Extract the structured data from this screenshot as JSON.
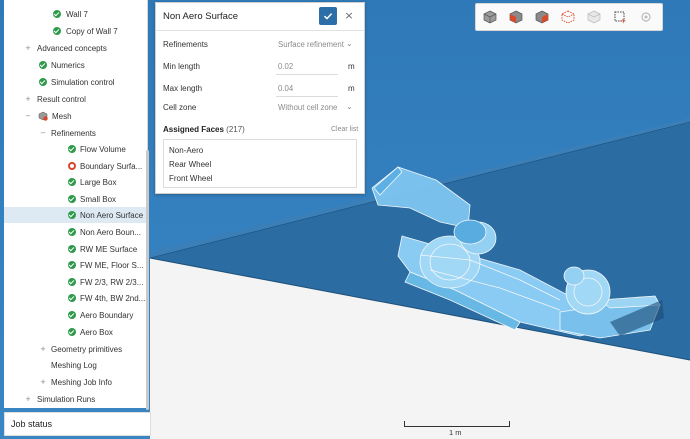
{
  "tree": {
    "items": [
      {
        "label": "Wall 7",
        "status": "ok"
      },
      {
        "label": "Copy of Wall 7",
        "status": "ok"
      },
      {
        "label": "Advanced concepts",
        "status": ""
      },
      {
        "label": "Numerics",
        "status": "ok"
      },
      {
        "label": "Simulation control",
        "status": "ok"
      },
      {
        "label": "Result control",
        "status": ""
      },
      {
        "label": "Mesh",
        "status": "mesh"
      },
      {
        "label": "Refinements",
        "status": ""
      },
      {
        "label": "Flow Volume",
        "status": "ok"
      },
      {
        "label": "Boundary Surfa...",
        "status": "warn"
      },
      {
        "label": "Large Box",
        "status": "ok"
      },
      {
        "label": "Small Box",
        "status": "ok"
      },
      {
        "label": "Non Aero Surface",
        "status": "ok"
      },
      {
        "label": "Non Aero Boun...",
        "status": "ok"
      },
      {
        "label": "RW ME Surface",
        "status": "ok"
      },
      {
        "label": "FW ME, Floor S...",
        "status": "ok"
      },
      {
        "label": "FW 2/3, RW 2/3...",
        "status": "ok"
      },
      {
        "label": "FW 4th, BW 2nd...",
        "status": "ok"
      },
      {
        "label": "Aero Boundary",
        "status": "ok"
      },
      {
        "label": "Aero Box",
        "status": "ok"
      },
      {
        "label": "Geometry primitives",
        "status": ""
      },
      {
        "label": "Meshing Log",
        "status": ""
      },
      {
        "label": "Meshing Job Info",
        "status": ""
      },
      {
        "label": "Simulation Runs",
        "status": ""
      }
    ]
  },
  "job_status": {
    "label": "Job status"
  },
  "dialog": {
    "title": "Non Aero Surface",
    "close_glyph": "×",
    "refinements_label": "Refinements",
    "refinements_value": "Surface refinement",
    "min_length_label": "Min length",
    "min_length_value": "0.02",
    "min_length_unit": "m",
    "max_length_label": "Max length",
    "max_length_value": "0.04",
    "max_length_unit": "m",
    "cell_zone_label": "Cell zone",
    "cell_zone_value": "Without cell zone",
    "assigned_faces_label": "Assigned Faces",
    "assigned_faces_count": "(217)",
    "clear_list_label": "Clear list",
    "faces": [
      "Non-Aero",
      "Rear Wheel",
      "Front Wheel"
    ]
  },
  "toolbar": {
    "icons": [
      "cube-iso-view-icon",
      "cube-front-view-icon",
      "cube-top-view-icon",
      "cube-wireframe-icon",
      "cube-hidden-icon",
      "box-select-icon",
      "settings-disabled-icon"
    ]
  },
  "scale": {
    "label": "1 m"
  },
  "colors": {
    "accent": "#2c6fa8",
    "viewport_bg": "#337ab7",
    "floor": "#2a6ca1",
    "model": "#8fd1f7",
    "ok": "#2e9a4a",
    "warn": "#d9472b"
  }
}
